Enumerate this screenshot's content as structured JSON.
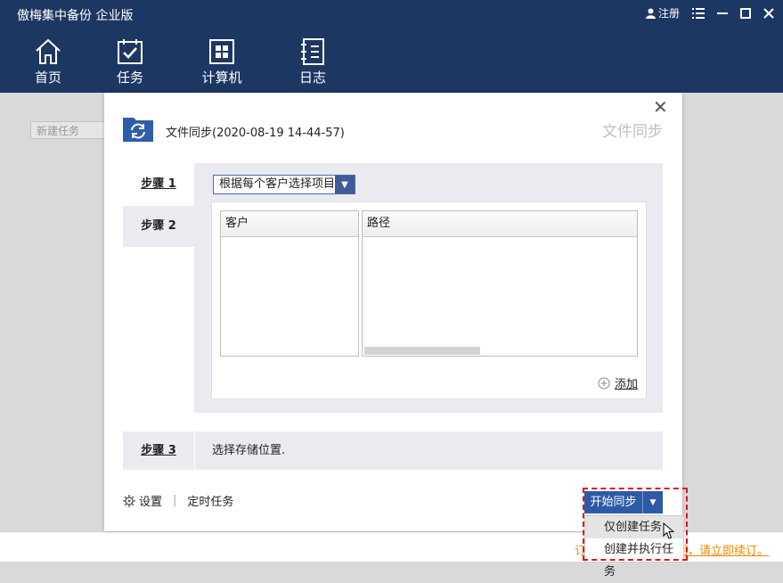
{
  "app": {
    "title": "傲梅集中备份 企业版",
    "register_label": "注册"
  },
  "nav": [
    {
      "label": "首页",
      "icon": "home-icon"
    },
    {
      "label": "任务",
      "icon": "task-icon"
    },
    {
      "label": "计算机",
      "icon": "windows-computer-icon"
    },
    {
      "label": "日志",
      "icon": "log-icon"
    }
  ],
  "background": {
    "new_task_placeholder": "新建任务",
    "warn_left": "订",
    "warn_right": "期，请立即续订。"
  },
  "dialog": {
    "title": "文件同步(2020-08-19 14-44-57)",
    "watermark": "文件同步",
    "steps": [
      {
        "label": "步骤 1"
      },
      {
        "label": "步骤 2"
      },
      {
        "label": "步骤 3",
        "text": "选择存储位置."
      }
    ],
    "select_value": "根据每个客户选择项目",
    "table_headers": [
      "客户",
      "路径"
    ],
    "add_label": "添加",
    "settings_label": "设置",
    "schedule_label": "定时任务",
    "start_label": "开始同步",
    "dropdown": [
      "仅创建任务",
      "创建并执行任务"
    ]
  },
  "colors": {
    "titlebar": "#1d3763",
    "accent": "#2d5aa7",
    "warn": "#e98a00",
    "highlight": "#e0141e"
  }
}
